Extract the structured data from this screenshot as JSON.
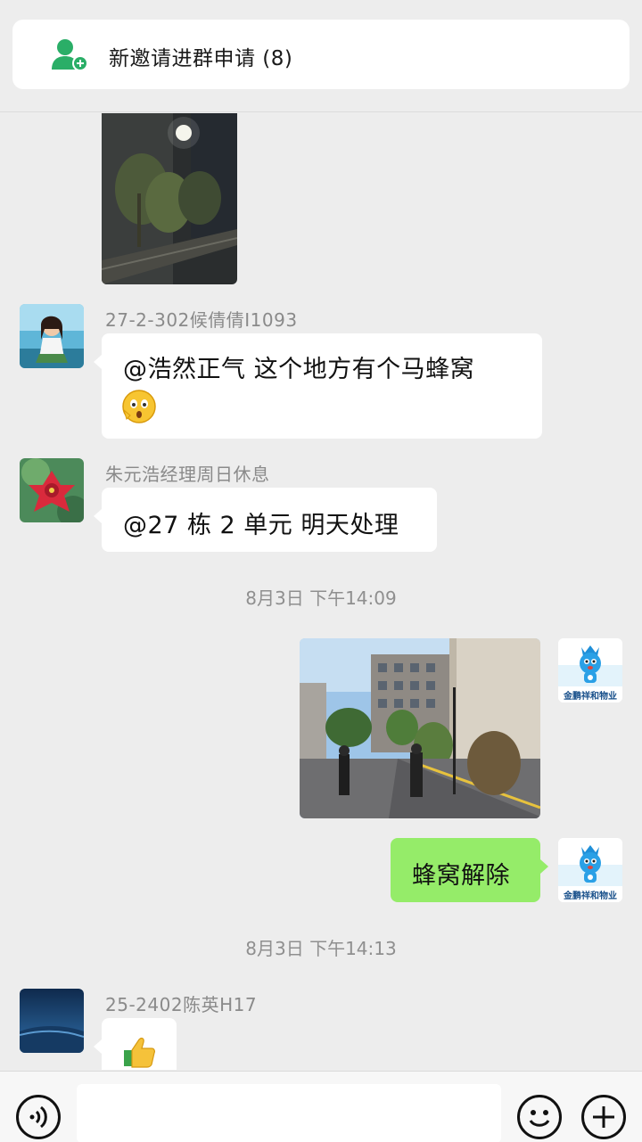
{
  "notice": {
    "text": "新邀请进群申请 (8)",
    "icon": "add-contact-icon"
  },
  "messages": [
    {
      "type": "image",
      "side": "left",
      "description_icon": "night-garden-photo"
    },
    {
      "type": "text",
      "side": "left",
      "sender": "27-2-302候倩倩I1093",
      "line1": "@浩然正气  这个地方有个马蜂窝",
      "emoji": "surprised-face-emoji"
    },
    {
      "type": "text",
      "side": "left",
      "sender": "朱元浩经理周日休息",
      "line1": "@27 栋 2 单元  明天处理"
    },
    {
      "type": "timestamp",
      "text": "8月3日 下午14:09"
    },
    {
      "type": "image",
      "side": "right",
      "description_icon": "courtyard-photo"
    },
    {
      "type": "text",
      "side": "right",
      "line1": "蜂窝解除"
    },
    {
      "type": "timestamp",
      "text": "8月3日 下午14:13"
    },
    {
      "type": "emoji",
      "side": "left",
      "sender": "25-2402陈英H17",
      "emoji": "thumbs-up-emoji"
    }
  ],
  "self_avatar_label": "金鹏祥和物业",
  "input": {
    "placeholder": "",
    "voice_icon": "voice-icon",
    "emoji_icon": "smile-icon",
    "plus_icon": "plus-icon"
  },
  "colors": {
    "background": "#ededed",
    "self_bubble": "#95ec69",
    "other_bubble": "#ffffff",
    "notice_icon": "#2aae67"
  }
}
